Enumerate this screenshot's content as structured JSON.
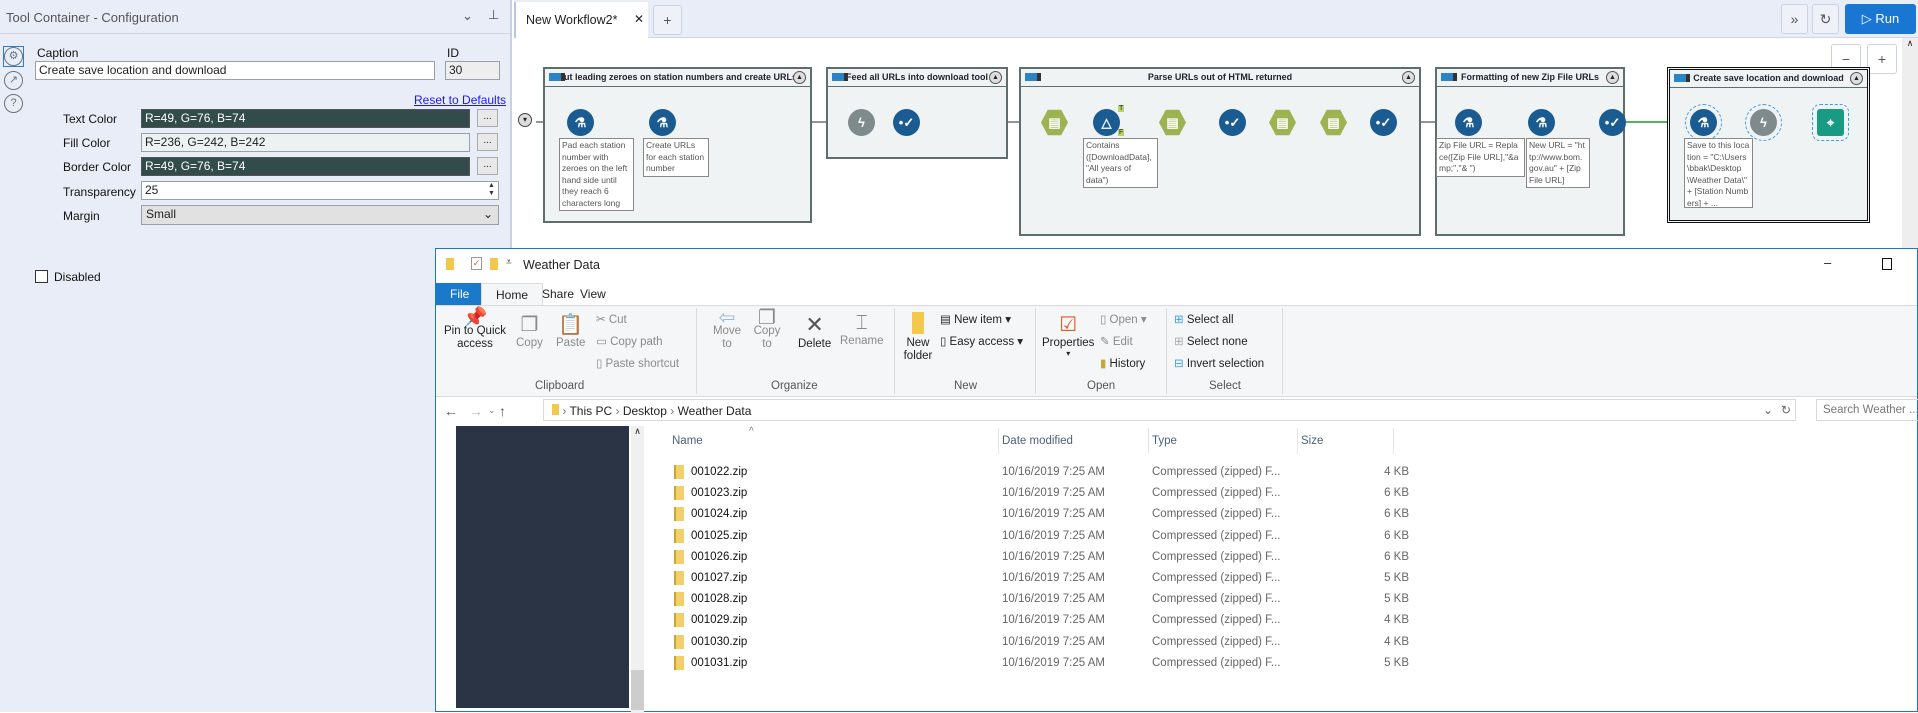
{
  "config_panel": {
    "title": "Tool Container - Configuration",
    "caption_label": "Caption",
    "caption_value": "Create save location and download",
    "id_label": "ID",
    "id_value": "30",
    "reset_link": "Reset to Defaults",
    "text_color_label": "Text Color",
    "text_color_value": "R=49, G=76, B=74",
    "fill_color_label": "Fill Color",
    "fill_color_value": "R=236, G=242, B=242",
    "border_color_label": "Border Color",
    "border_color_value": "R=49, G=76, B=74",
    "transparency_label": "Transparency",
    "transparency_value": "25",
    "margin_label": "Margin",
    "margin_value": "Small",
    "disabled_label": "Disabled",
    "browse_label": "...",
    "colors": {
      "text": "#314c4a",
      "fill": "#ecf2f2",
      "border": "#314c4a"
    }
  },
  "workflow": {
    "tab_label": "New Workflow2*",
    "run_label": "Run",
    "containers": [
      {
        "title": "Put leading zeroes on station numbers and create URLs",
        "annotations": [
          "Pad each station number with zeroes on the left hand side until they reach 6 characters long",
          "Create URLs for each station number"
        ]
      },
      {
        "title": "Feed all URLs into download tool"
      },
      {
        "title": "Parse URLs out of HTML returned",
        "annotations": [
          "Contains ([DownloadData], \"All years of data\")"
        ]
      },
      {
        "title": "Formatting of new Zip File URLs",
        "annotations": [
          "Zip File URL = Replace([Zip File URL],\"&amp;\",\"& \")",
          "New URL = \"http://www.bom.gov.au\" + [Zip File URL]"
        ]
      },
      {
        "title": "Create save location and download",
        "annotations": [
          "Save to this location = \"C:\\Users\\bbak\\Desktop\\Weather Data\\\" + [Station Numbers] + ..."
        ]
      }
    ],
    "filter_true": "T",
    "filter_false": "F"
  },
  "explorer": {
    "title": "Weather Data",
    "tabs": [
      "File",
      "Home",
      "Share",
      "View"
    ],
    "ribbon": {
      "pin": "Pin to Quick access",
      "copy": "Copy",
      "paste": "Paste",
      "cut": "Cut",
      "copy_path": "Copy path",
      "paste_shortcut": "Paste shortcut",
      "clipboard": "Clipboard",
      "move_to": "Move to",
      "copy_to": "Copy to",
      "delete": "Delete",
      "rename": "Rename",
      "organize": "Organize",
      "new_folder": "New folder",
      "new_item": "New item",
      "easy_access": "Easy access",
      "new": "New",
      "properties": "Properties",
      "open": "Open",
      "edit": "Edit",
      "history": "History",
      "open_group": "Open",
      "select_all": "Select all",
      "select_none": "Select none",
      "invert_selection": "Invert selection",
      "select_group": "Select"
    },
    "breadcrumb": [
      "This PC",
      "Desktop",
      "Weather Data"
    ],
    "search_placeholder": "Search Weather ...",
    "columns": [
      "Name",
      "Date modified",
      "Type",
      "Size"
    ],
    "files": [
      {
        "name": "001022.zip",
        "date": "10/16/2019 7:25 AM",
        "type": "Compressed (zipped) F...",
        "size": "4 KB"
      },
      {
        "name": "001023.zip",
        "date": "10/16/2019 7:25 AM",
        "type": "Compressed (zipped) F...",
        "size": "6 KB"
      },
      {
        "name": "001024.zip",
        "date": "10/16/2019 7:25 AM",
        "type": "Compressed (zipped) F...",
        "size": "6 KB"
      },
      {
        "name": "001025.zip",
        "date": "10/16/2019 7:25 AM",
        "type": "Compressed (zipped) F...",
        "size": "6 KB"
      },
      {
        "name": "001026.zip",
        "date": "10/16/2019 7:25 AM",
        "type": "Compressed (zipped) F...",
        "size": "6 KB"
      },
      {
        "name": "001027.zip",
        "date": "10/16/2019 7:25 AM",
        "type": "Compressed (zipped) F...",
        "size": "5 KB"
      },
      {
        "name": "001028.zip",
        "date": "10/16/2019 7:25 AM",
        "type": "Compressed (zipped) F...",
        "size": "5 KB"
      },
      {
        "name": "001029.zip",
        "date": "10/16/2019 7:25 AM",
        "type": "Compressed (zipped) F...",
        "size": "4 KB"
      },
      {
        "name": "001030.zip",
        "date": "10/16/2019 7:25 AM",
        "type": "Compressed (zipped) F...",
        "size": "4 KB"
      },
      {
        "name": "001031.zip",
        "date": "10/16/2019 7:25 AM",
        "type": "Compressed (zipped) F...",
        "size": "5 KB"
      }
    ]
  }
}
